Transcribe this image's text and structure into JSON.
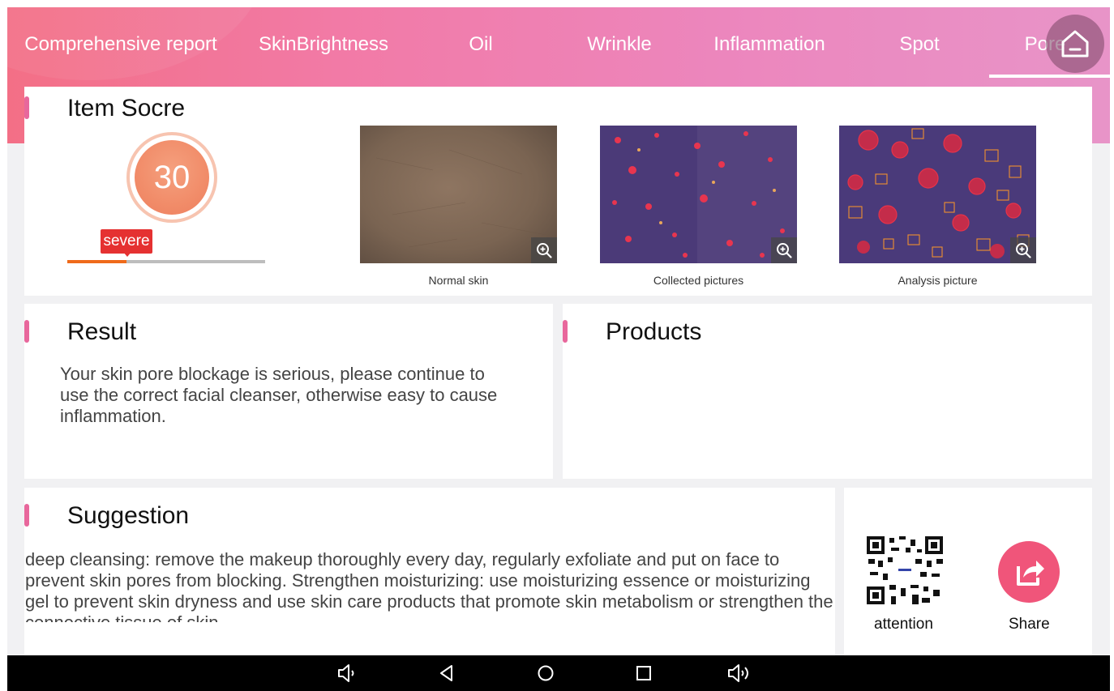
{
  "tabs": [
    {
      "label": "Comprehensive report"
    },
    {
      "label": "SkinBrightness"
    },
    {
      "label": "Oil"
    },
    {
      "label": "Wrinkle"
    },
    {
      "label": "Inflammation"
    },
    {
      "label": "Spot"
    },
    {
      "label": "Pore"
    }
  ],
  "active_tab": "Pore",
  "home_icon": "home-icon",
  "item_score": {
    "title": "Item Socre",
    "score": "30",
    "severity": "severe",
    "severity_level_fraction": 0.3
  },
  "photos": [
    {
      "caption": "Normal skin"
    },
    {
      "caption": "Collected pictures"
    },
    {
      "caption": "Analysis picture"
    }
  ],
  "result": {
    "title": "Result",
    "text": "Your skin pore blockage is serious, please continue to use the correct facial cleanser, otherwise easy to cause inflammation."
  },
  "products": {
    "title": "Products"
  },
  "suggestion": {
    "title": "Suggestion",
    "text": "deep cleansing: remove the makeup thoroughly every day, regularly exfoliate and put on face to prevent skin pores from blocking. Strengthen moisturizing: use moisturizing essence or moisturizing gel to prevent skin dryness and use skin care products that promote skin metabolism or strengthen the connective tissue of skin"
  },
  "actions": {
    "attention_label": "attention",
    "share_label": "Share"
  },
  "colors": {
    "accent_pink": "#e8679c",
    "header_start": "#f36f86",
    "header_end": "#e894c8",
    "score_orange": "#f18c69",
    "severity_red": "#e53131",
    "share_pink": "#f0557a"
  },
  "navbar_icons": [
    "volume-down-icon",
    "back-icon",
    "home-circle-icon",
    "recent-apps-icon",
    "volume-up-icon"
  ]
}
